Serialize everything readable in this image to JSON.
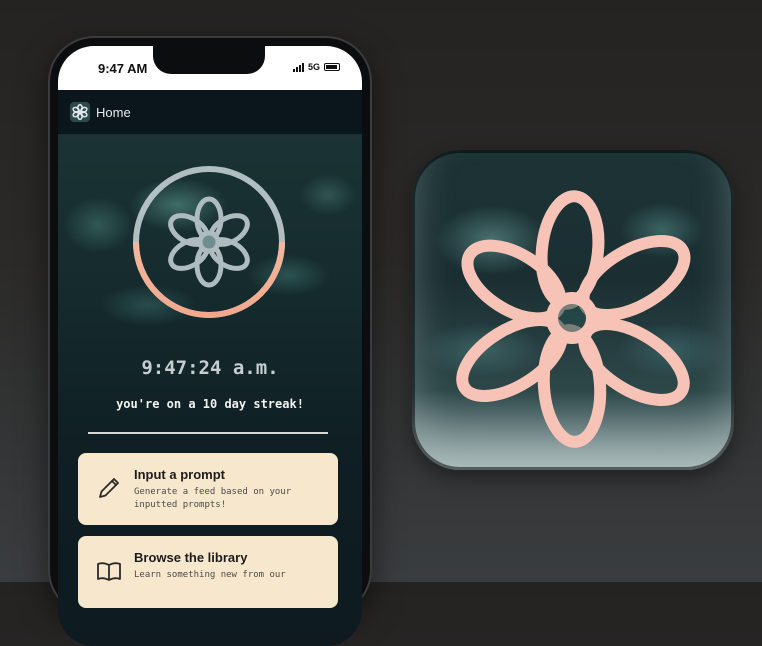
{
  "status_bar": {
    "time": "9:47 AM",
    "network": "5G"
  },
  "nav": {
    "icon": "flower-logo-icon",
    "title": "Home"
  },
  "hero": {
    "clock": "9:47:24 a.m.",
    "streak": "you're on a 10 day streak!",
    "progress_fraction": 0.5
  },
  "cards": [
    {
      "icon": "pencil-icon",
      "title": "Input a prompt",
      "description": "Generate a feed based on your inputted prompts!"
    },
    {
      "icon": "book-icon",
      "title": "Browse the library",
      "description": "Learn something new from our"
    }
  ],
  "colors": {
    "accent_peach": "#f4b59a",
    "card_bg": "#f7e8cd",
    "flower_pink": "#f6c1b3"
  },
  "app_icon": {
    "icon": "flower-icon"
  }
}
